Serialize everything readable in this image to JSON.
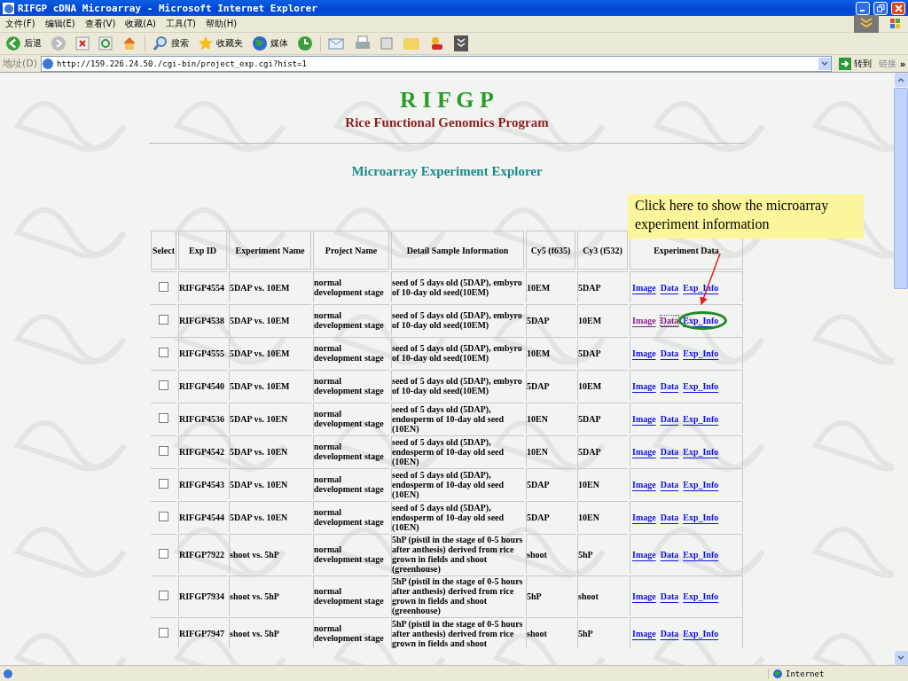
{
  "window": {
    "title": "RIFGP cDNA Microarray - Microsoft Internet Explorer"
  },
  "menu": [
    "文件(F)",
    "编辑(E)",
    "查看(V)",
    "收藏(A)",
    "工具(T)",
    "帮助(H)"
  ],
  "toolbar": {
    "back": "后退",
    "search": "搜索",
    "favorites": "收藏夹",
    "media": "媒体"
  },
  "address": {
    "label": "地址(D)",
    "url": "http://159.226.24.50./cgi-bin/project_exp.cgi?hist=1",
    "go": "转到",
    "links": "链接",
    "more": "»"
  },
  "page": {
    "logo": "R I F G P",
    "subtitle": "Rice Functional Genomics Program",
    "heading": "Microarray Experiment Explorer",
    "callout": "Click here to show the microarray experiment information",
    "table": {
      "columns": [
        "Select",
        "Exp ID",
        "Experiment Name",
        "Project Name",
        "Detail Sample Information",
        "Cy5 (f635)",
        "Cy3 (f532)",
        "Experiment Data"
      ],
      "rows": [
        {
          "checked": false,
          "id": "RIFGP4554",
          "name": "5DAP vs. 10EM",
          "project": "normal development stage",
          "detail": "seed of 5 days old (5DAP), embyro of 10-day old seed(10EM)",
          "cy5": "10EM",
          "cy3": "5DAP",
          "links": [
            {
              "label": "Image",
              "visited": false
            },
            {
              "label": "Data",
              "visited": false
            },
            {
              "label": "Exp_Info",
              "visited": false
            }
          ]
        },
        {
          "checked": false,
          "id": "RIFGP4538",
          "name": "5DAP vs. 10EM",
          "project": "normal development stage",
          "detail": "seed of 5 days old (5DAP), embyro of 10-day old seed(10EM)",
          "cy5": "5DAP",
          "cy3": "10EM",
          "links": [
            {
              "label": "Image",
              "visited": true
            },
            {
              "label": "Data",
              "visited": true,
              "focused": true
            },
            {
              "label": "Exp_Info",
              "visited": false,
              "circled": true
            }
          ]
        },
        {
          "checked": false,
          "id": "RIFGP4555",
          "name": "5DAP vs. 10EM",
          "project": "normal development stage",
          "detail": "seed of 5 days old (5DAP), embyro of 10-day old seed(10EM)",
          "cy5": "10EM",
          "cy3": "5DAP",
          "links": [
            {
              "label": "Image",
              "visited": false
            },
            {
              "label": "Data",
              "visited": false
            },
            {
              "label": "Exp_Info",
              "visited": false
            }
          ]
        },
        {
          "checked": false,
          "id": "RIFGP4540",
          "name": "5DAP vs. 10EM",
          "project": "normal development stage",
          "detail": "seed of 5 days old (5DAP), embyro of 10-day old seed(10EM)",
          "cy5": "5DAP",
          "cy3": "10EM",
          "links": [
            {
              "label": "Image",
              "visited": false
            },
            {
              "label": "Data",
              "visited": false
            },
            {
              "label": "Exp_Info",
              "visited": false
            }
          ]
        },
        {
          "checked": false,
          "id": "RIFGP4536",
          "name": "5DAP vs. 10EN",
          "project": "normal development stage",
          "detail": "seed of 5 days old (5DAP), endosperm of 10-day old seed (10EN)",
          "cy5": "10EN",
          "cy3": "5DAP",
          "links": [
            {
              "label": "Image",
              "visited": false
            },
            {
              "label": "Data",
              "visited": false
            },
            {
              "label": "Exp_Info",
              "visited": false
            }
          ]
        },
        {
          "checked": false,
          "id": "RIFGP4542",
          "name": "5DAP vs. 10EN",
          "project": "normal development stage",
          "detail": "seed of 5 days old (5DAP), endosperm of 10-day old seed (10EN)",
          "cy5": "10EN",
          "cy3": "5DAP",
          "links": [
            {
              "label": "Image",
              "visited": false
            },
            {
              "label": "Data",
              "visited": false
            },
            {
              "label": "Exp_Info",
              "visited": false
            }
          ]
        },
        {
          "checked": false,
          "id": "RIFGP4543",
          "name": "5DAP vs. 10EN",
          "project": "normal development stage",
          "detail": "seed of 5 days old (5DAP), endosperm of 10-day old seed (10EN)",
          "cy5": "5DAP",
          "cy3": "10EN",
          "links": [
            {
              "label": "Image",
              "visited": false
            },
            {
              "label": "Data",
              "visited": false
            },
            {
              "label": "Exp_Info",
              "visited": false
            }
          ]
        },
        {
          "checked": false,
          "id": "RIFGP4544",
          "name": "5DAP vs. 10EN",
          "project": "normal development stage",
          "detail": "seed of 5 days old (5DAP), endosperm of 10-day old seed (10EN)",
          "cy5": "5DAP",
          "cy3": "10EN",
          "links": [
            {
              "label": "Image",
              "visited": false
            },
            {
              "label": "Data",
              "visited": false
            },
            {
              "label": "Exp_Info",
              "visited": false
            }
          ]
        },
        {
          "checked": false,
          "id": "RIFGP7922",
          "name": "shoot vs. 5hP",
          "project": "normal development stage",
          "detail": "5hP (pistil in the stage of 0-5 hours after anthesis) derived from rice grown in fields and shoot (greenhouse)",
          "cy5": "shoot",
          "cy3": "5hP",
          "links": [
            {
              "label": "Image",
              "visited": false
            },
            {
              "label": "Data",
              "visited": false
            },
            {
              "label": "Exp_Info",
              "visited": false
            }
          ]
        },
        {
          "checked": false,
          "id": "RIFGP7934",
          "name": "shoot vs. 5hP",
          "project": "normal development stage",
          "detail": "5hP (pistil in the stage of 0-5 hours after anthesis) derived from rice grown in fields and shoot (greenhouse)",
          "cy5": "5hP",
          "cy3": "shoot",
          "links": [
            {
              "label": "Image",
              "visited": false
            },
            {
              "label": "Data",
              "visited": false
            },
            {
              "label": "Exp_Info",
              "visited": false
            }
          ]
        },
        {
          "checked": false,
          "id": "RIFGP7947",
          "name": "shoot vs. 5hP",
          "project": "normal development stage",
          "detail": "5hP (pistil in the stage of 0-5 hours after anthesis) derived from rice grown in fields and shoot",
          "cy5": "shoot",
          "cy3": "5hP",
          "links": [
            {
              "label": "Image",
              "visited": false
            },
            {
              "label": "Data",
              "visited": false
            },
            {
              "label": "Exp_Info",
              "visited": false
            }
          ]
        }
      ]
    }
  },
  "status_bar": {
    "zone": "Internet"
  }
}
